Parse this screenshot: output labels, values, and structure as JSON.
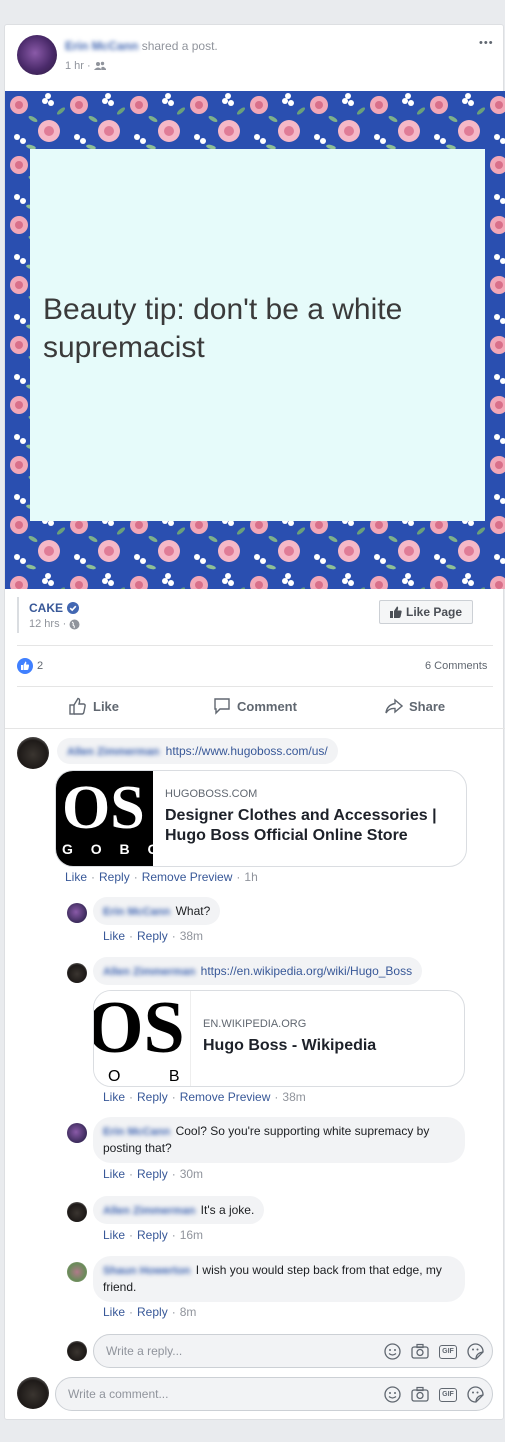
{
  "post": {
    "author_name": "Erin McCann",
    "action_text": "shared a post.",
    "time": "1 hr",
    "more_glyph": "•••",
    "image_text": "Beauty tip: don't be a white supremacist"
  },
  "shared_page": {
    "name": "CAKE",
    "time": "12 hrs",
    "like_page_label": "Like Page"
  },
  "reactions": {
    "count": "2",
    "comments": "6 Comments"
  },
  "action_bar": {
    "like": "Like",
    "comment": "Comment",
    "share": "Share"
  },
  "comments": [
    {
      "author": "Allen Zimmerman",
      "text": "https://www.hugoboss.com/us/",
      "preview": {
        "domain": "HUGOBOSS.COM",
        "title": "Designer Clothes and Accessories | Hugo Boss Official Online Store",
        "logo_big": "OS",
        "logo_small": "G O B O"
      },
      "actions": {
        "like": "Like",
        "reply": "Reply",
        "remove": "Remove Preview",
        "time": "1h"
      }
    }
  ],
  "replies": [
    {
      "author": "Erin McCann",
      "text": "What?",
      "actions": {
        "like": "Like",
        "reply": "Reply",
        "time": "38m"
      }
    },
    {
      "author": "Allen Zimmerman",
      "text": "https://en.wikipedia.org/wiki/Hugo_Boss",
      "preview": {
        "domain": "EN.WIKIPEDIA.ORG",
        "title": "Hugo Boss - Wikipedia",
        "logo_big": "OS",
        "logo_small": "O B"
      },
      "actions": {
        "like": "Like",
        "reply": "Reply",
        "remove": "Remove Preview",
        "time": "38m"
      }
    },
    {
      "author": "Erin McCann",
      "text": "Cool? So you're supporting white supremacy by posting that?",
      "actions": {
        "like": "Like",
        "reply": "Reply",
        "time": "30m"
      }
    },
    {
      "author": "Allen Zimmerman",
      "text": "It's a joke.",
      "actions": {
        "like": "Like",
        "reply": "Reply",
        "time": "16m"
      }
    },
    {
      "author": "Shaun Howerton",
      "text": "I wish you would step back from that edge, my friend.",
      "actions": {
        "like": "Like",
        "reply": "Reply",
        "time": "8m"
      }
    }
  ],
  "reply_input": {
    "placeholder": "Write a reply..."
  },
  "comment_input": {
    "placeholder": "Write a comment..."
  },
  "colors": {
    "link": "#385898",
    "brand": "#4267b2",
    "floral_bg": "#2a4fb0",
    "image_panel": "#e6fbfa"
  },
  "separator_dot": "·",
  "gif_label": "GIF"
}
